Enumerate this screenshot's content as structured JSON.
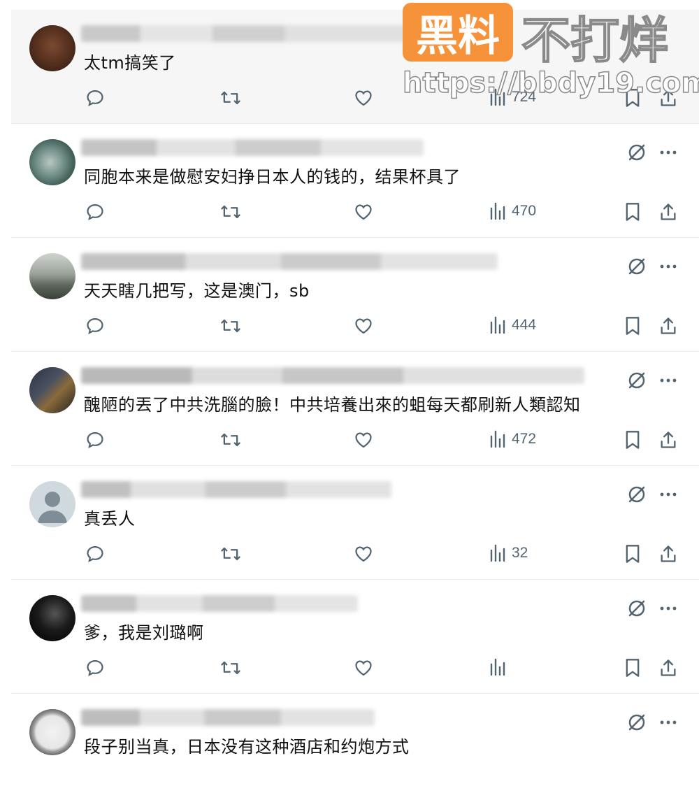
{
  "watermark": {
    "badge": "黑料",
    "title": "不打烊",
    "url": "https://bbdy19.com"
  },
  "colors": {
    "icon_gray": "#536471",
    "badge_orange": "#f5923a"
  },
  "posts": [
    {
      "text": "太tm搞笑了",
      "views": "724"
    },
    {
      "text": "同胞本来是做慰安妇挣日本人的钱的，结果杯具了",
      "views": "470"
    },
    {
      "text": "天天瞎几把写，这是澳门，sb",
      "views": "444"
    },
    {
      "text": "醜陋的丟了中共洗腦的臉！中共培養出來的蛆每天都刷新人類認知",
      "views": "472"
    },
    {
      "text": "真丢人",
      "views": "32"
    },
    {
      "text": "爹，我是刘璐啊",
      "views": ""
    },
    {
      "text": "段子别当真，日本没有这种酒店和约炮方式",
      "views": ""
    }
  ],
  "icons": [
    "reply-icon",
    "retweet-icon",
    "like-icon",
    "views-icon",
    "bookmark-icon",
    "share-icon",
    "grok-icon",
    "more-icon"
  ]
}
